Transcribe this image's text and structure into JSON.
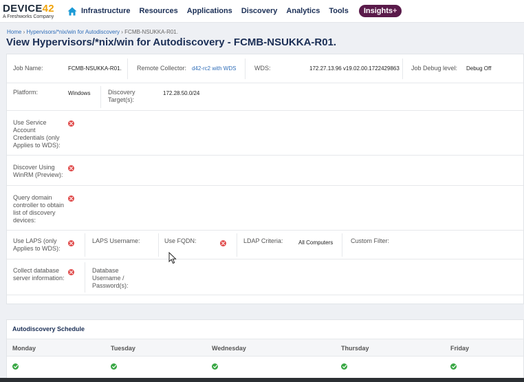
{
  "brand": {
    "name_main": "DEVICE",
    "name_num": "42",
    "tagline": "A Freshworks Company"
  },
  "nav": {
    "items": [
      "Infrastructure",
      "Resources",
      "Applications",
      "Discovery",
      "Analytics",
      "Tools"
    ],
    "insights_label": "Insights",
    "insights_plus": "+"
  },
  "breadcrumb": {
    "home": "Home",
    "sep": " › ",
    "parent": "Hypervisors/*nix/win for Autodiscovery",
    "current": "FCMB-NSUKKA-R01."
  },
  "page_title": "View Hypervisors/*nix/win for Autodiscovery - FCMB-NSUKKA-R01.",
  "job": {
    "job_name_label": "Job Name:",
    "job_name": "FCMB-NSUKKA-R01.",
    "remote_collector_label": "Remote Collector:",
    "remote_collector": "d42-rc2 with WDS",
    "wds_label": "WDS:",
    "wds": "172.27.13.96 v19.02.00.1722429863",
    "debug_label": "Job Debug level:",
    "debug": "Debug Off",
    "platform_label": "Platform:",
    "platform": "Windows",
    "targets_label": "Discovery Target(s):",
    "targets": "172.28.50.0/24",
    "service_account_label": "Use Service Account Credentials (only Applies to WDS):",
    "winrm_label": "Discover Using WinRM (Preview):",
    "domain_label": "Query domain controller to obtain list of discovery devices:",
    "laps_label": "Use LAPS (only Applies to WDS):",
    "laps_username_label": "LAPS Username:",
    "fqdn_label": "Use FQDN:",
    "ldap_label": "LDAP Criteria:",
    "ldap": "All Computers",
    "custom_filter_label": "Custom Filter:",
    "db_info_label": "Collect database server information:",
    "db_creds_label": "Database Username / Password(s):"
  },
  "schedule": {
    "title": "Autodiscovery Schedule",
    "days": [
      "Monday",
      "Tuesday",
      "Wednesday",
      "Thursday",
      "Friday"
    ]
  },
  "colors": {
    "navy": "#1a2e55",
    "link": "#2f6db8",
    "no": "#e04b4b",
    "yes": "#3aa845",
    "insights": "#5a1a4a",
    "accent": "#f0a30a"
  }
}
